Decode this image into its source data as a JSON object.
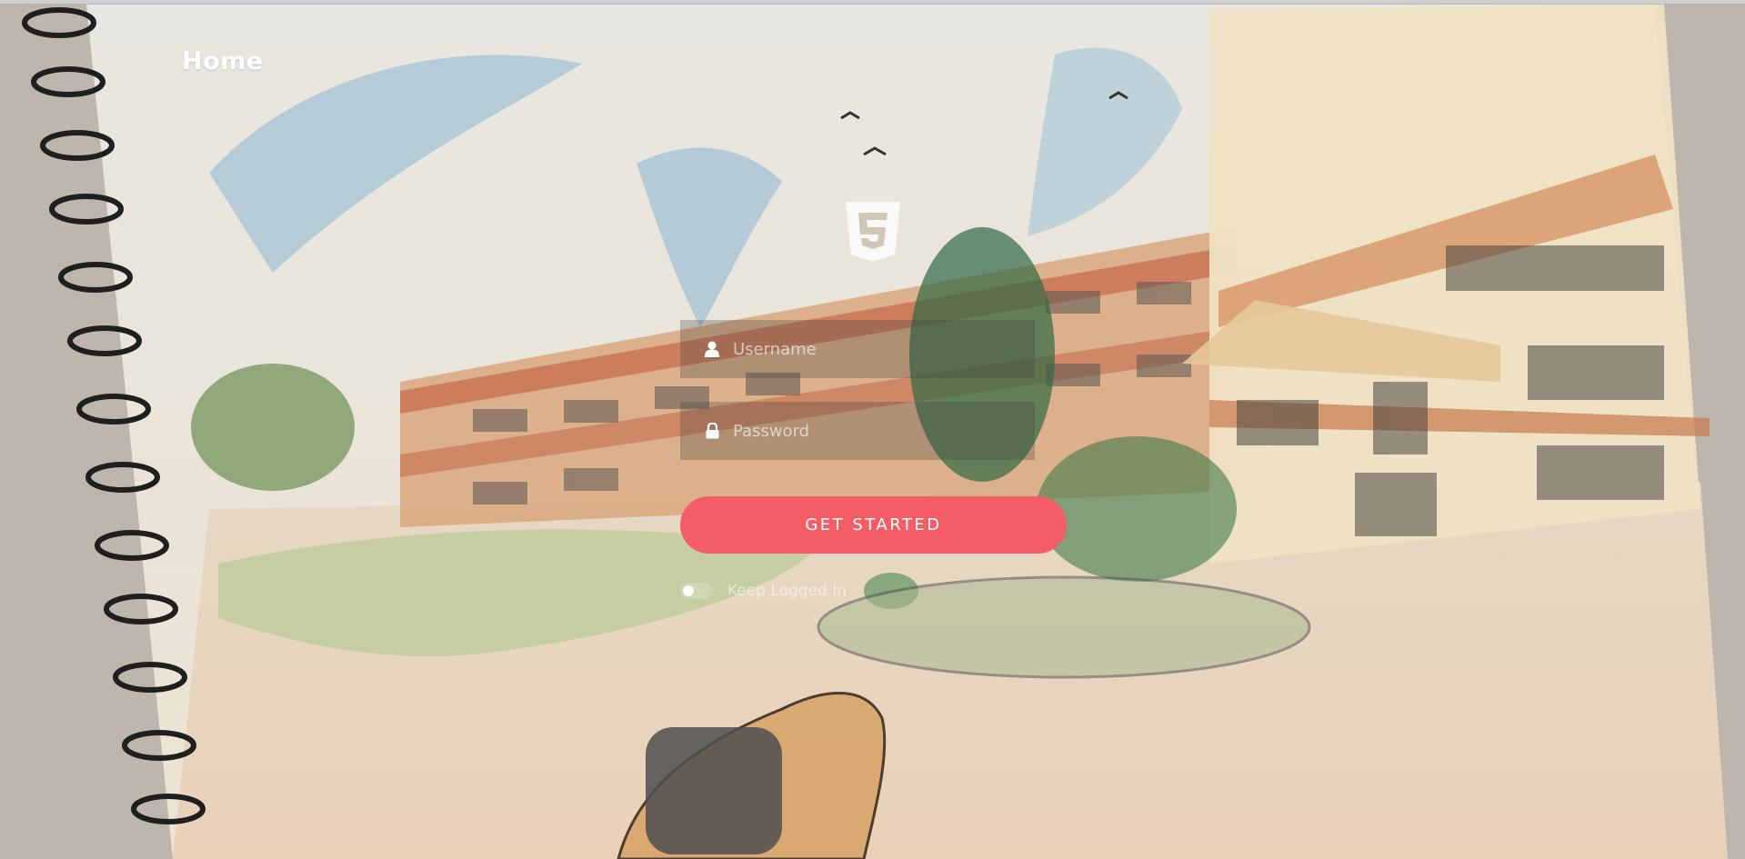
{
  "header": {
    "title": "Home"
  },
  "logo": {
    "icon": "html5-shield-icon"
  },
  "login": {
    "username": {
      "placeholder": "Username",
      "value": "",
      "icon": "user-icon"
    },
    "password": {
      "placeholder": "Password",
      "value": "",
      "icon": "lock-icon"
    },
    "submit_label": "GET STARTED",
    "remember_label": "Keep Logged In",
    "remember_checked": false
  },
  "colors": {
    "accent": "#f45c66",
    "text_light": "#ffffff"
  }
}
